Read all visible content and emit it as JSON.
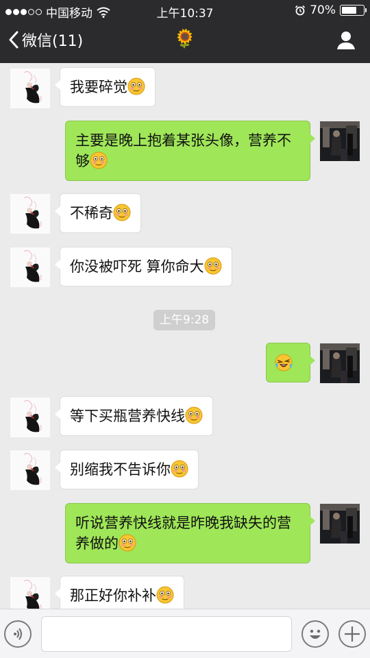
{
  "status_bar": {
    "carrier": "中国移动",
    "time": "上午10:37",
    "battery": "70%",
    "battery_level": 0.7
  },
  "nav": {
    "back_label": "微信(11)",
    "title": "🌻"
  },
  "timestamp": "上午9:28",
  "messages": [
    {
      "side": "left",
      "text": "我要碎觉",
      "emoji": "flushed-emoji"
    },
    {
      "side": "right",
      "text": "主要是晚上抱着某张头像，营养不够",
      "emoji": "flushed-emoji"
    },
    {
      "side": "left",
      "text": "不稀奇",
      "emoji": "flushed-emoji"
    },
    {
      "side": "left",
      "text": "你没被吓死 算你命大",
      "emoji": "flushed-emoji"
    },
    {
      "side": "right",
      "text": "",
      "emoji": "laughing-tears-emoji"
    },
    {
      "side": "left",
      "text": "等下买瓶营养快线",
      "emoji": "flushed-emoji"
    },
    {
      "side": "left",
      "text": "别缩我不告诉你",
      "emoji": "flushed-emoji"
    },
    {
      "side": "right",
      "text": "听说营养快线就是昨晚我缺失的营养做的",
      "emoji": "flushed-emoji"
    },
    {
      "side": "left",
      "text": "那正好你补补",
      "emoji": "flushed-emoji"
    }
  ],
  "input": {
    "value": "",
    "placeholder": ""
  },
  "colors": {
    "header_bg": "#2b2b2e",
    "chat_bg": "#ebebeb",
    "my_bubble": "#9fe659",
    "their_bubble": "#ffffff"
  }
}
